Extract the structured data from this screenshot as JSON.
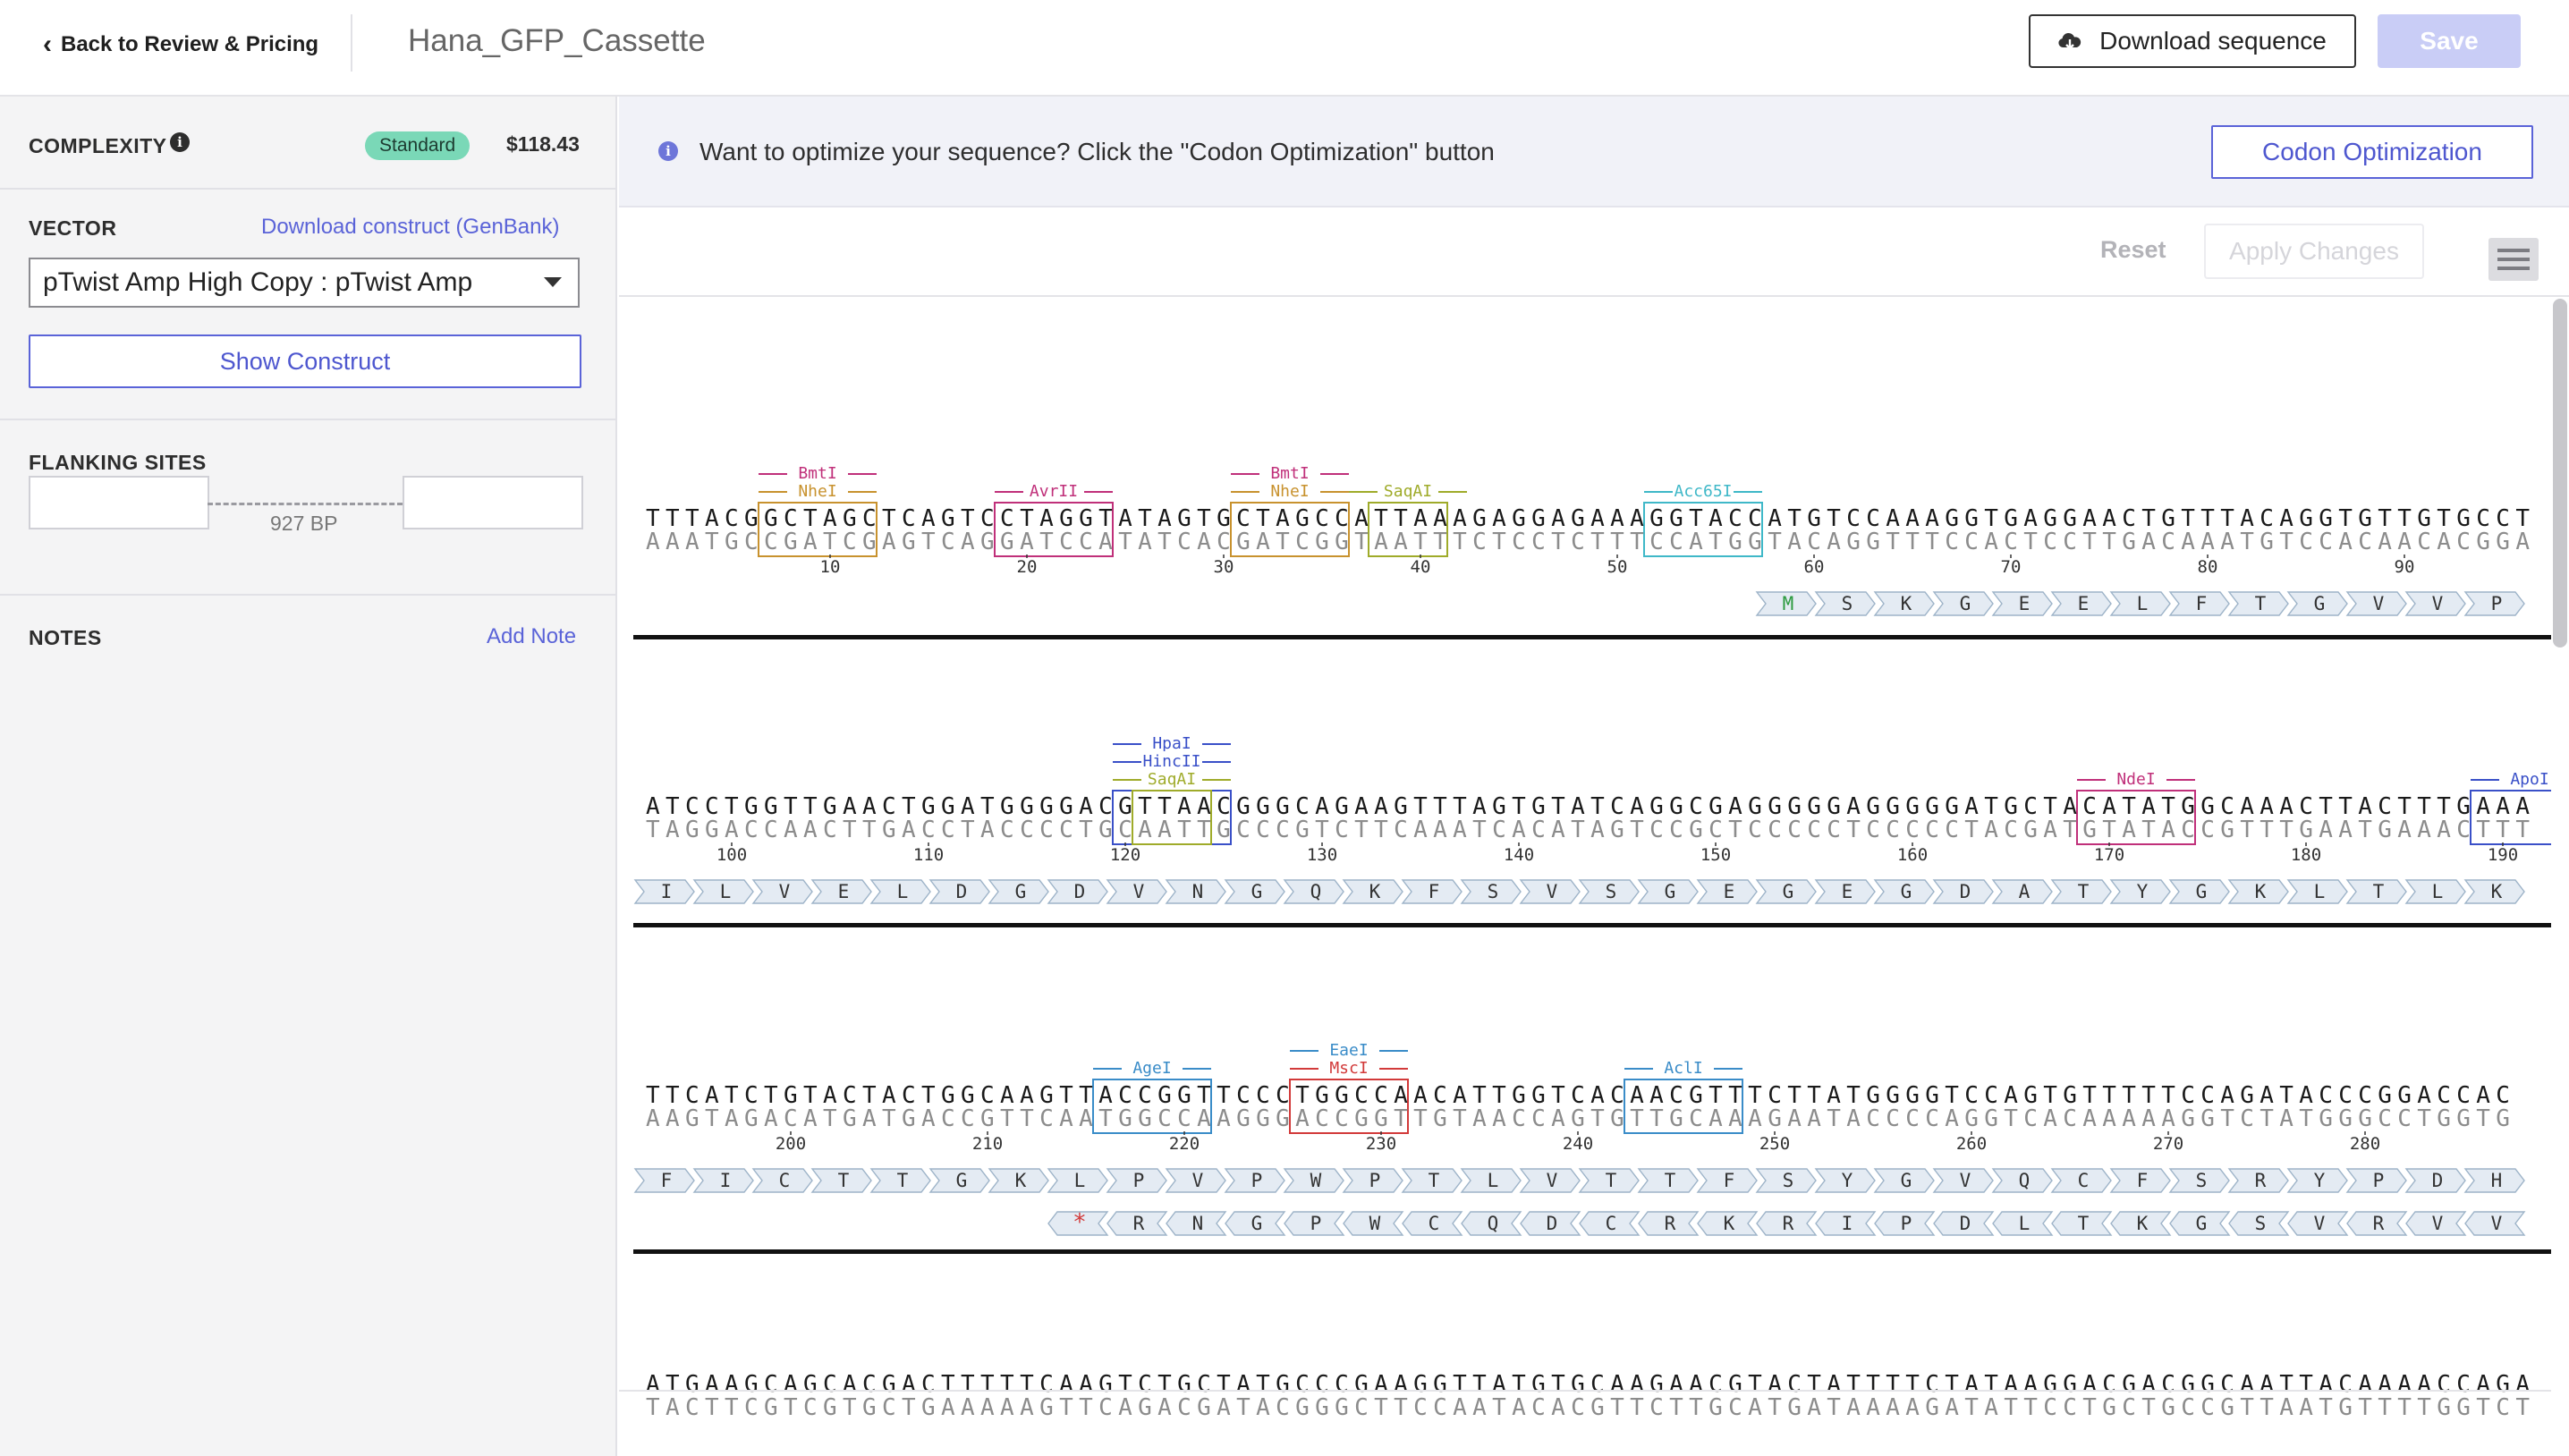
{
  "header": {
    "back_label": "Back to Review & Pricing",
    "title": "Hana_GFP_Cassette",
    "download_label": "Download sequence",
    "save_label": "Save"
  },
  "sidebar": {
    "complexity": {
      "label": "COMPLEXITY",
      "badge": "Standard",
      "price": "$118.43"
    },
    "vector": {
      "label": "VECTOR",
      "download_link": "Download construct (GenBank)",
      "selected": "pTwist Amp High Copy : pTwist Amp",
      "show_construct": "Show Construct"
    },
    "flanking": {
      "label": "FLANKING SITES",
      "bp": "927 BP"
    },
    "notes": {
      "label": "NOTES",
      "add_note": "Add Note"
    }
  },
  "main": {
    "info_message": "Want to optimize your sequence? Click the \"Codon Optimization\" button",
    "codon_button": "Codon Optimization",
    "reset_label": "Reset",
    "apply_label": "Apply Changes"
  },
  "colors": {
    "accent": "#5a63d8",
    "badge": "#7ad8b7",
    "save_disabled": "#c9cdf6",
    "enzyme_pink": "#c0307a",
    "enzyme_orange": "#c8922e",
    "enzyme_olive": "#9fab2a",
    "enzyme_teal": "#3fb8c8",
    "enzyme_blue": "#3a50c8",
    "enzyme_red": "#d23a3a",
    "enzyme_cyan": "#3a8cc8"
  },
  "icons": [
    "chevron-left-icon",
    "cloud-download-icon",
    "info-icon",
    "hamburger-menu-icon",
    "stop-codon-icon"
  ],
  "sequence_rows": [
    {
      "top": "TTTACGGCTAGCTCAGTCCTAGGTATAGTGCTAGCCATTAAAGAGGAGAAAGGTACCATGTCCAAAGGTGAGGAACTGTTTACAGGTGTTGTGCCT",
      "bottom": "AAATGCCGATCGAGTCAGGATCCATATCACGATCGGTAATTTCTCCTCTTTCCATGGTACAGGTTTCCACTCCTTGACAAATGTCCACAACACGGA",
      "ticks": [
        "10",
        "20",
        "30",
        "40",
        "50",
        "60",
        "70",
        "80",
        "90"
      ],
      "enzymes": [
        "BmtI",
        "NheI",
        "AvrII",
        "BmtI",
        "NheI",
        "SaqAI",
        "Acc65I"
      ],
      "fwd_aa": [
        "M",
        "S",
        "K",
        "G",
        "E",
        "E",
        "L",
        "F",
        "T",
        "G",
        "V",
        "V",
        "P"
      ],
      "rev_aa": []
    },
    {
      "top": "ATCCTGGTTGAACTGGATGGGGACGTTAACGGGCAGAAGTTTAGTGTATCAGGCGAGGGGGAGGGGGATGCTACATATGGCAAACTTACTTTGAAA",
      "bottom": "TAGGACCAACTTGACCTACCCCTGCAATTGCCCGTCTTCAAATCACATAGTCCGCTCCCCCTCCCCCTACGATGTATACCGTTTGAATGAAACTTT",
      "ticks": [
        "100",
        "110",
        "120",
        "130",
        "140",
        "150",
        "160",
        "170",
        "180",
        "190"
      ],
      "enzymes": [
        "HpaI",
        "HincII",
        "SaqAI",
        "NdeI",
        "ApoI"
      ],
      "fwd_aa": [
        "I",
        "L",
        "V",
        "E",
        "L",
        "D",
        "G",
        "D",
        "V",
        "N",
        "G",
        "Q",
        "K",
        "F",
        "S",
        "V",
        "S",
        "G",
        "E",
        "G",
        "E",
        "G",
        "D",
        "A",
        "T",
        "Y",
        "G",
        "K",
        "L",
        "T",
        "L",
        "K"
      ],
      "rev_aa": []
    },
    {
      "top": "TTCATCTGTACTACTGGCAAGTTACCGGTTCCCTGGCCAACATTGGTCACAACGTTTCTTATGGGGTCCAGTGTTTTTCCAGATACCCGGACCAC",
      "bottom": "AAGTAGACATGATGACCGTTCAATGGCCAAGGGACCGGTTGTAACCAGTGTTGCAAAGAATACCCCAGGTCACAAAAAGGTCTATGGGCCTGGTG",
      "ticks": [
        "200",
        "210",
        "220",
        "230",
        "240",
        "250",
        "260",
        "270",
        "280"
      ],
      "enzymes": [
        "AgeI",
        "EaeI",
        "MscI",
        "AclI"
      ],
      "fwd_aa": [
        "F",
        "I",
        "C",
        "T",
        "T",
        "G",
        "K",
        "L",
        "P",
        "V",
        "P",
        "W",
        "P",
        "T",
        "L",
        "V",
        "T",
        "T",
        "F",
        "S",
        "Y",
        "G",
        "V",
        "Q",
        "C",
        "F",
        "S",
        "R",
        "Y",
        "P",
        "D",
        "H"
      ],
      "rev_aa": [
        "*",
        "R",
        "N",
        "G",
        "P",
        "W",
        "C",
        "Q",
        "D",
        "C",
        "R",
        "K",
        "R",
        "I",
        "P",
        "D",
        "L",
        "T",
        "K",
        "G",
        "S",
        "V",
        "R",
        "V",
        "V"
      ]
    },
    {
      "top": "ATGAAGCAGCACGACTTTTTCAAGTCTGCTATGCCCGAAGGTTATGTGCAAGAACGTACTATTTTCTATAAGGACGACGGCAATTACAAAACCAGA",
      "bottom": "TACTTCGTCGTGCTGAAAAAGTTCAGACGATACGGGCTTCCAATACACGTTCTTGCATGATAAAAGATATTCCTGCTGCCGTTAATGTTTTGGTCT",
      "ticks": [],
      "enzymes": [],
      "fwd_aa": [],
      "rev_aa": []
    }
  ]
}
